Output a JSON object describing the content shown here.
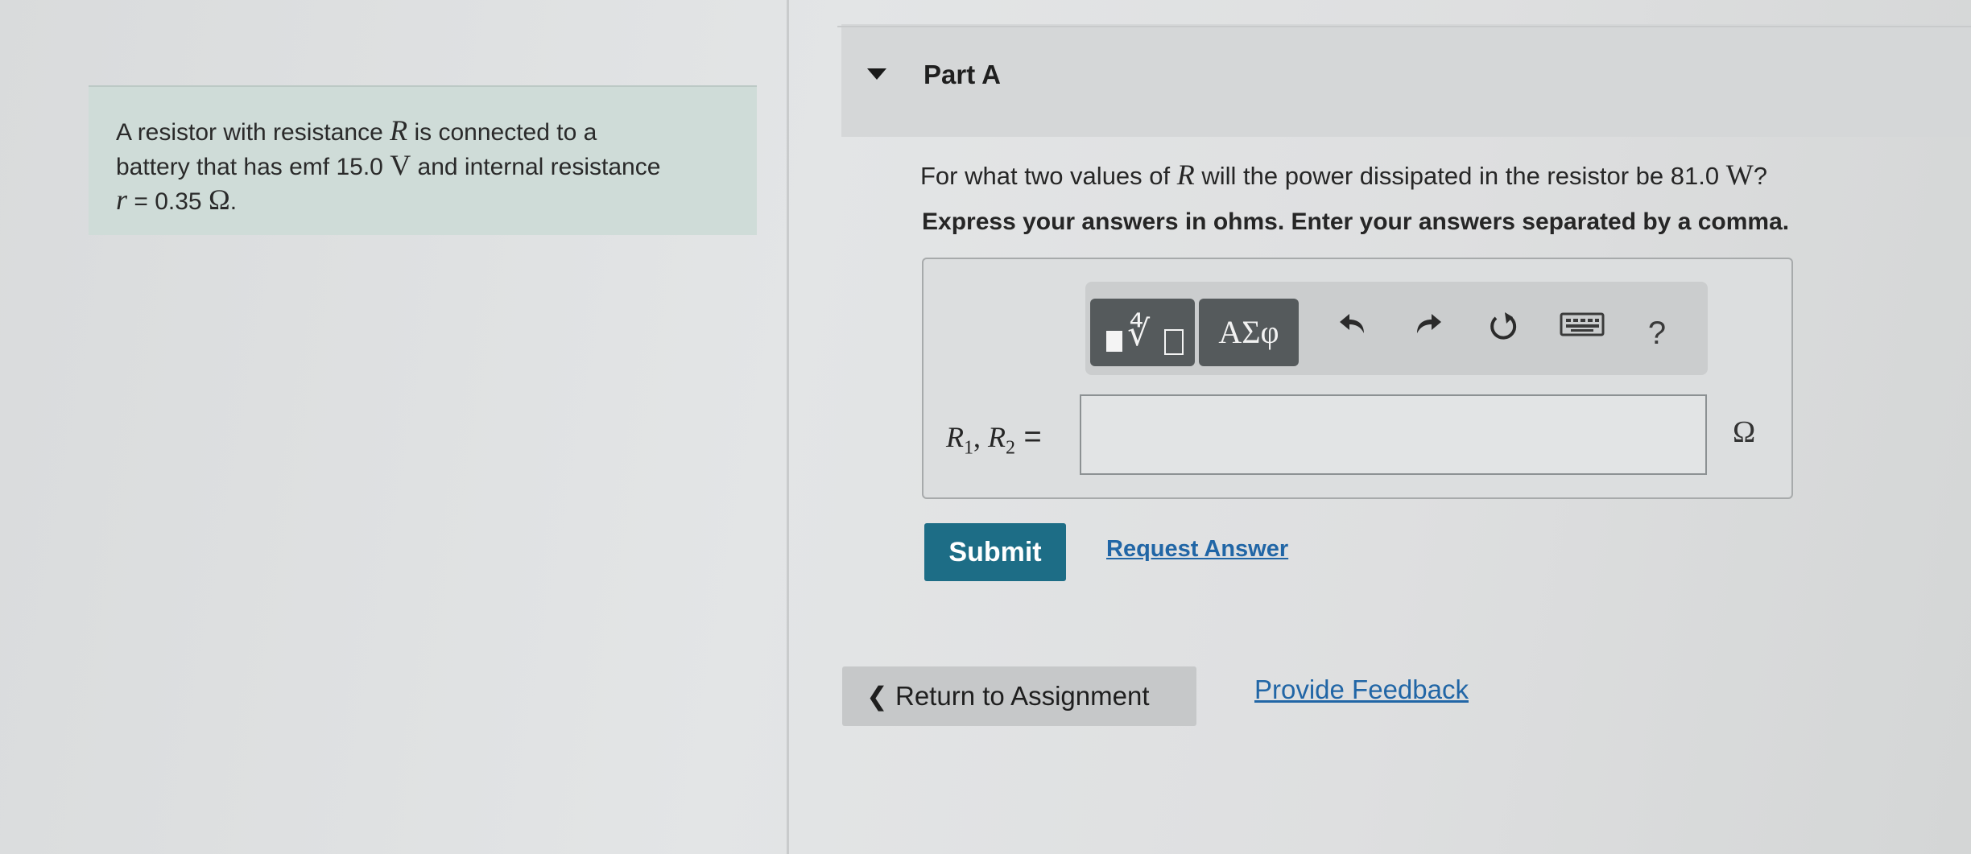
{
  "problem": {
    "line1_pre": "A resistor with resistance ",
    "line1_var": "R",
    "line1_post": " is connected to a",
    "line2_pre": "battery that has emf 15.0 ",
    "line2_unit": "V",
    "line2_post": " and internal resistance",
    "line3_var": "r",
    "line3_eq": " = 0.35 ",
    "line3_unit": "Ω",
    "line3_end": "."
  },
  "part": {
    "title": "Part A",
    "question_pre": "For what two values of ",
    "question_var": "R",
    "question_mid": " will the power dissipated in the resistor be 81.0 ",
    "question_unit": "W",
    "question_end": "?",
    "instructions": "Express your answers in ohms. Enter your answers separated by a comma."
  },
  "toolbar": {
    "greek_label": "ΑΣφ",
    "help_label": "?"
  },
  "answer": {
    "var1": "R",
    "sub1": "1",
    "sep": ", ",
    "var2": "R",
    "sub2": "2",
    "equals": " =",
    "value": "",
    "unit": "Ω"
  },
  "actions": {
    "submit_label": "Submit",
    "request_label": "Request Answer",
    "return_label": "Return to Assignment",
    "feedback_label": "Provide Feedback"
  },
  "icons": {
    "caret": "caret-down-icon",
    "undo": "undo-icon",
    "redo": "redo-icon",
    "reset": "reset-icon",
    "keyboard": "keyboard-icon",
    "chevron": "chevron-left-icon"
  },
  "colors": {
    "submit": "#1d6d86",
    "link": "#2166a6",
    "problem_bg": "#cfdcd8"
  }
}
